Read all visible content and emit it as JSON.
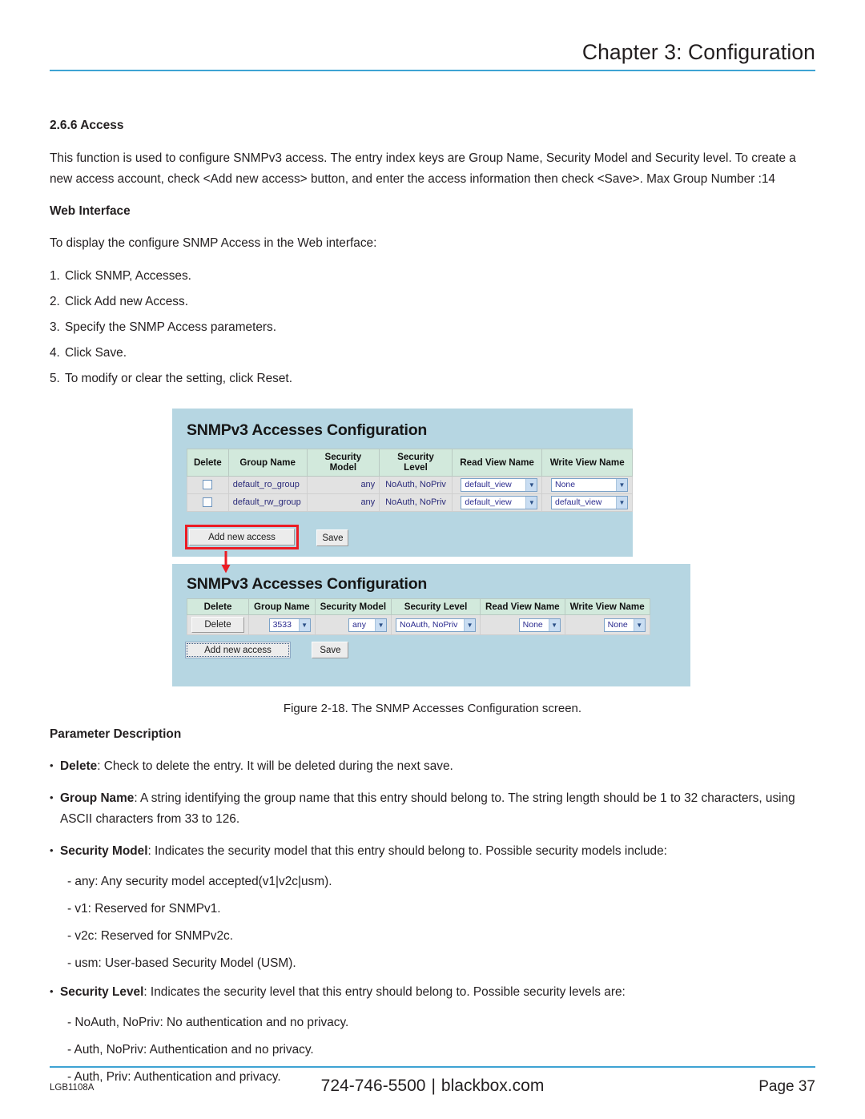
{
  "header": {
    "chapter_title": "Chapter 3: Configuration"
  },
  "section": {
    "heading": "2.6.6 Access",
    "intro": "This function is used to configure SNMPv3 access. The entry index keys are Group Name, Security Model and Security level. To create a new access account, check <Add new access> button, and enter the access information then check <Save>. Max Group Number :14",
    "web_interface_heading": "Web Interface",
    "web_interface_intro": "To display the configure SNMP Access in the Web interface:",
    "steps": [
      {
        "num": "1.",
        "text": "Click SNMP, Accesses."
      },
      {
        "num": "2.",
        "text": "Click Add new Access."
      },
      {
        "num": "3.",
        "text": "Specify the SNMP Access parameters."
      },
      {
        "num": "4.",
        "text": "Click Save."
      },
      {
        "num": "5.",
        "text": "To modify or clear the setting, click Reset."
      }
    ]
  },
  "figure": {
    "caption": "Figure 2-18. The SNMP Accesses Configuration screen.",
    "panel1": {
      "title": "SNMPv3 Accesses Configuration",
      "columns": [
        "Delete",
        "Group Name",
        "Security\nModel",
        "Security\nLevel",
        "Read View Name",
        "Write View Name"
      ],
      "rows": [
        {
          "delete_checked": false,
          "group_name": "default_ro_group",
          "security_model": "any",
          "security_level": "NoAuth, NoPriv",
          "read_view_name": "default_view",
          "write_view_name": "None"
        },
        {
          "delete_checked": false,
          "group_name": "default_rw_group",
          "security_model": "any",
          "security_level": "NoAuth, NoPriv",
          "read_view_name": "default_view",
          "write_view_name": "default_view"
        }
      ],
      "add_new_access_label": "Add new access",
      "save_label": "Save",
      "highlight_color": "#ec1c24"
    },
    "panel2": {
      "title": "SNMPv3 Accesses Configuration",
      "columns": [
        "Delete",
        "Group Name",
        "Security Model",
        "Security Level",
        "Read View Name",
        "Write View Name"
      ],
      "row": {
        "delete_label": "Delete",
        "group_name": "3533",
        "security_model": "any",
        "security_level": "NoAuth, NoPriv",
        "read_view_name": "None",
        "write_view_name": "None"
      },
      "add_new_access_label": "Add new access",
      "save_label": "Save"
    },
    "panel_background": "#b6d6e2",
    "table_header_background": "#d2e9dc"
  },
  "parameters": {
    "heading": "Parameter Description",
    "items": [
      {
        "term": "Delete",
        "rest": ": Check to delete the entry. It will be deleted during the next save.",
        "subs": []
      },
      {
        "term": "Group Name",
        "rest": ": A string identifying the group name that this entry should belong to. The string length should be 1 to 32 characters, using ASCII characters from 33 to 126.",
        "subs": []
      },
      {
        "term": "Security Model",
        "rest": ": Indicates the security model that this entry should belong to. Possible security models include:",
        "subs": [
          "- any: Any security model accepted(v1|v2c|usm).",
          "- v1: Reserved for SNMPv1.",
          "- v2c: Reserved for SNMPv2c.",
          "- usm: User-based Security Model (USM)."
        ]
      },
      {
        "term": "Security Level",
        "rest": ": Indicates the security level that this entry should belong to. Possible security levels are:",
        "subs": [
          "- NoAuth, NoPriv: No authentication and no privacy.",
          "- Auth, NoPriv: Authentication and no privacy.",
          "- Auth, Priv: Authentication and privacy."
        ]
      }
    ]
  },
  "footer": {
    "model": "LGB1108A",
    "phone": "724-746-5500",
    "separator": "|",
    "website": "blackbox.com",
    "page": "Page 37",
    "rule_color": "#3ea3d3"
  }
}
